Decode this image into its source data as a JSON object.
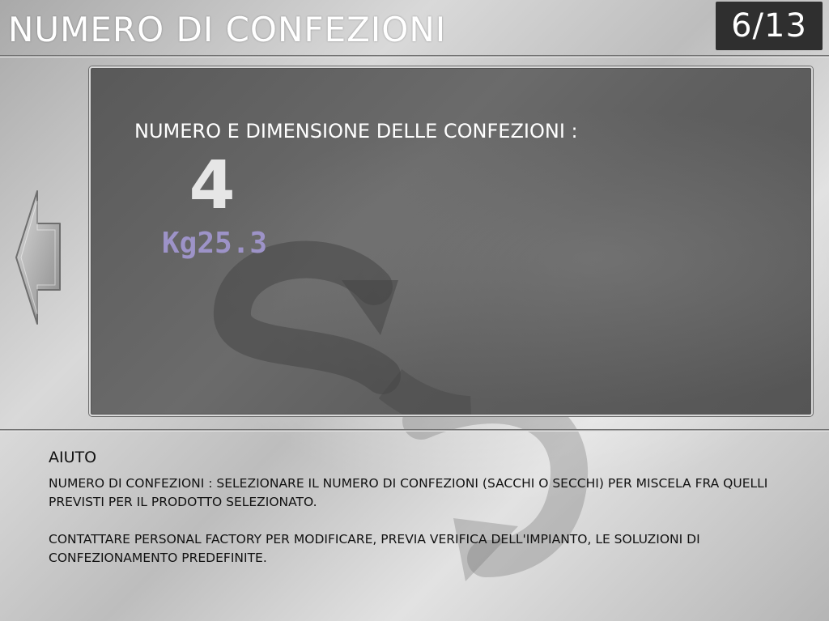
{
  "header": {
    "title": "NUMERO DI CONFEZIONI",
    "page_counter": "6/13"
  },
  "navigation": {
    "back_icon": "left-arrow-icon"
  },
  "panel": {
    "label": "NUMERO E DIMENSIONE DELLE CONFEZIONI :",
    "pack_count": "4",
    "pack_weight": "Kg25.3"
  },
  "help": {
    "title": "AIUTO",
    "paragraph_1": "NUMERO DI CONFEZIONI : SELEZIONARE IL NUMERO DI CONFEZIONI (SACCHI O SECCHI) PER MISCELA FRA QUELLI PREVISTI PER IL PRODOTTO SELEZIONATO.",
    "paragraph_2": "CONTATTARE PERSONAL FACTORY PER MODIFICARE, PREVIA VERIFICA DELL'IMPIANTO, LE SOLUZIONI DI CONFEZIONAMENTO PREDEFINITE."
  },
  "colors": {
    "panel_bg": "#5f5f5f",
    "counter_bg": "#2f2f2f",
    "weight_text": "#9d93c8",
    "count_text": "#e6e6e6"
  }
}
